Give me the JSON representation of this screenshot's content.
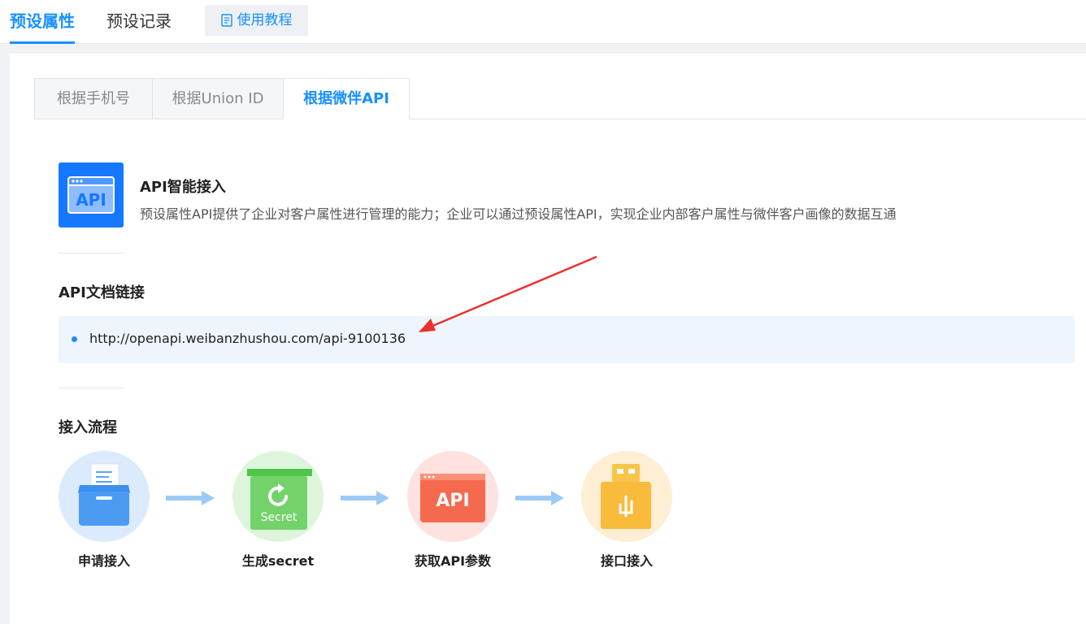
{
  "header": {
    "tabs": [
      {
        "label": "预设属性",
        "active": true
      },
      {
        "label": "预设记录",
        "active": false
      }
    ],
    "tutorial_label": "使用教程"
  },
  "subtabs": [
    {
      "label": "根据手机号",
      "active": false
    },
    {
      "label": "根据Union ID",
      "active": false
    },
    {
      "label": "根据微伴API",
      "active": true
    }
  ],
  "intro": {
    "logo_text": "API",
    "title": "API智能接入",
    "description": "预设属性API提供了企业对客户属性进行管理的能力；企业可以通过预设属性API，实现企业内部客户属性与微伴客户画像的数据互通"
  },
  "doc_link": {
    "title": "API文档链接",
    "url": "http://openapi.weibanzhushou.com/api-9100136"
  },
  "flow": {
    "title": "接入流程",
    "steps": [
      {
        "label": "申请接入",
        "icon": "folder-icon"
      },
      {
        "label": "生成secret",
        "icon": "secret-icon",
        "icon_text": "Secret"
      },
      {
        "label": "获取API参数",
        "icon": "api-icon",
        "icon_text": "API"
      },
      {
        "label": "接口接入",
        "icon": "usb-icon"
      }
    ]
  },
  "colors": {
    "accent": "#1890ff",
    "annotation_arrow": "#e8322d"
  }
}
